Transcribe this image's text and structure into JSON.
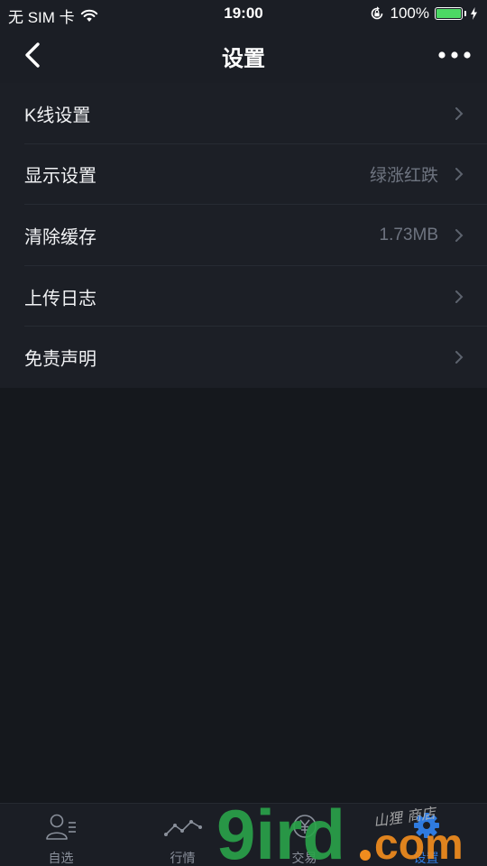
{
  "status_bar": {
    "carrier": "无 SIM 卡",
    "time": "19:00",
    "battery_percent": "100%",
    "battery_level": 1.0,
    "icons": [
      "wifi-icon",
      "orientation-lock-icon",
      "battery-icon"
    ]
  },
  "nav": {
    "title": "设置",
    "back_icon": "chevron-left-icon",
    "more_icon": "more-icon"
  },
  "settings": {
    "items": [
      {
        "label": "K线设置",
        "value": ""
      },
      {
        "label": "显示设置",
        "value": "绿涨红跌"
      },
      {
        "label": "清除缓存",
        "value": "1.73MB"
      },
      {
        "label": "上传日志",
        "value": ""
      },
      {
        "label": "免责声明",
        "value": ""
      }
    ]
  },
  "tabs": [
    {
      "label": "自选",
      "icon": "user-list-icon",
      "active": false
    },
    {
      "label": "行情",
      "icon": "market-line-icon",
      "active": false
    },
    {
      "label": "交易",
      "icon": "yuan-coin-icon",
      "active": false
    },
    {
      "label": "设置",
      "icon": "gear-icon",
      "active": true
    }
  ],
  "watermark": {
    "text": "9ird.com",
    "script": "山狸 商店"
  },
  "colors": {
    "background": "#15181d",
    "bar": "#1b1e25",
    "list": "#1c1f26",
    "accent": "#2f7be0",
    "value_text": "#6e7480",
    "battery": "#4cd964",
    "watermark_green": "#2aa34a",
    "watermark_orange": "#f08c1e"
  }
}
